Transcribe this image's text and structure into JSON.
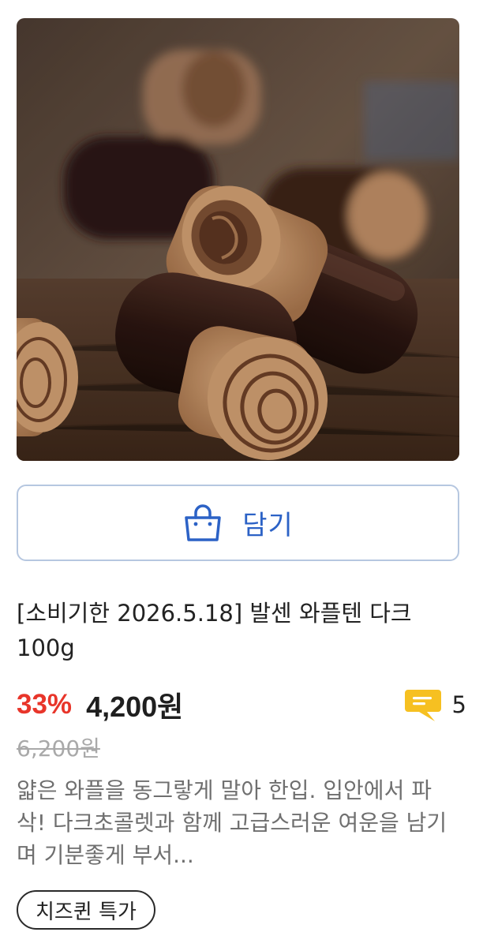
{
  "product": {
    "image_alt": "waffle rolls with dark chocolate",
    "cart_button": {
      "label": "담기",
      "icon": "shopping-bag-icon"
    },
    "title": "[소비기한 2026.5.18] 발센 와플텐 다크 100g",
    "discount": "33%",
    "price": "4,200원",
    "original_price": "6,200원",
    "review": {
      "icon": "speech-bubble-icon",
      "count": "5"
    },
    "description": "얇은 와플을 동그랗게 말아 한입. 입안에서 파삭! 다크초콜렛과 함께 고급스러운 여운을 남기며 기분좋게 부서...",
    "tag": "치즈퀸 특가"
  },
  "colors": {
    "accent_blue": "#2c62c6",
    "discount_red": "#e8352a",
    "review_yellow": "#f6c021",
    "button_border": "#b6c7e0"
  }
}
